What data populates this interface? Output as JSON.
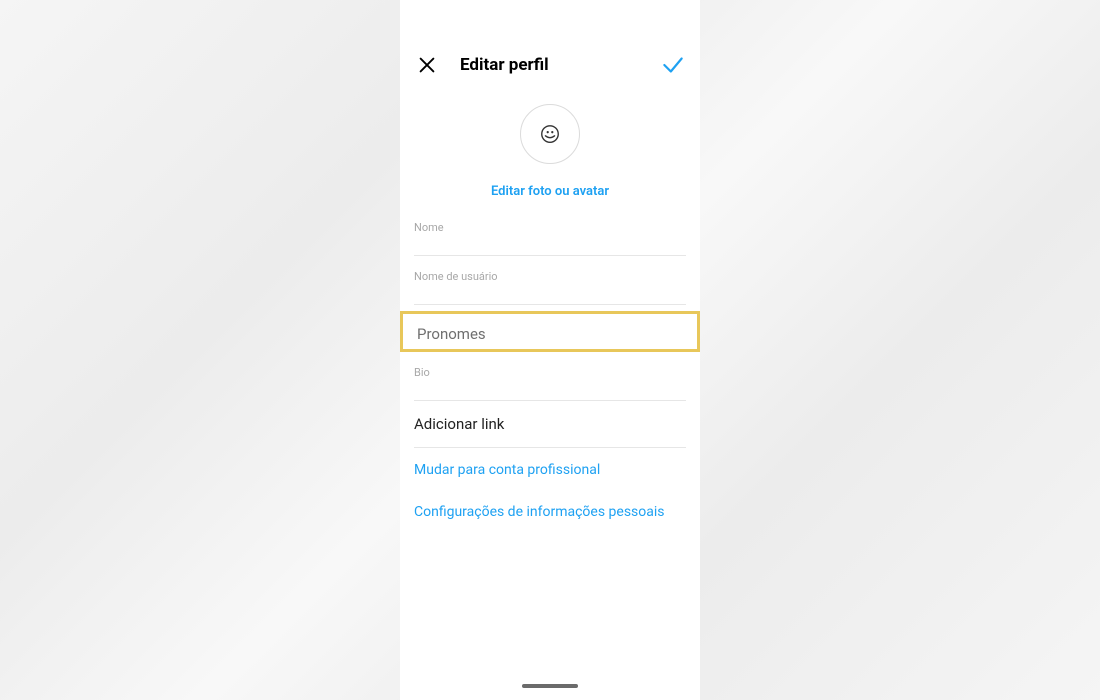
{
  "header": {
    "title": "Editar perfil"
  },
  "avatar": {
    "edit_link": "Editar foto ou avatar"
  },
  "fields": {
    "name_label": "Nome",
    "username_label": "Nome de usuário",
    "pronouns_label": "Pronomes",
    "bio_label": "Bio",
    "add_link_label": "Adicionar link"
  },
  "options": {
    "switch_pro": "Mudar para conta profissional",
    "personal_info": "Configurações de informações pessoais"
  }
}
